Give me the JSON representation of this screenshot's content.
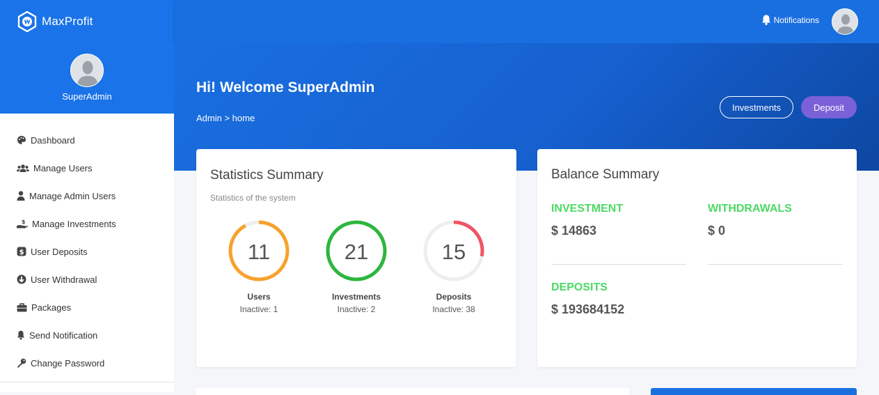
{
  "brand": {
    "name": "MaxProfit"
  },
  "topbar": {
    "notifications_label": "Notifications"
  },
  "profile": {
    "name": "SuperAdmin"
  },
  "sidebar": {
    "items": [
      {
        "label": "Dashboard",
        "icon": "palette-icon"
      },
      {
        "label": "Manage Users",
        "icon": "users-icon"
      },
      {
        "label": "Manage Admin Users",
        "icon": "user-icon"
      },
      {
        "label": "Manage Investments",
        "icon": "hand-dollar-icon"
      },
      {
        "label": "User Deposits",
        "icon": "dollar-badge-icon"
      },
      {
        "label": "User Withdrawal",
        "icon": "arrow-down-circle-icon"
      },
      {
        "label": "Packages",
        "icon": "briefcase-icon"
      },
      {
        "label": "Send Notification",
        "icon": "bell-icon"
      },
      {
        "label": "Change Password",
        "icon": "key-icon"
      }
    ]
  },
  "hero": {
    "title": "Hi! Welcome SuperAdmin",
    "breadcrumb": "Admin > home",
    "investments_button": "Investments",
    "deposit_button": "Deposit"
  },
  "stats": {
    "title": "Statistics Summary",
    "subtitle": "Statistics of the system",
    "items": [
      {
        "value": "11",
        "label": "Users",
        "sub": "Inactive: 1",
        "color": "#f7a22e",
        "fraction": 0.92
      },
      {
        "value": "21",
        "label": "Investments",
        "sub": "Inactive: 2",
        "color": "#2cb63e",
        "fraction": 1.0
      },
      {
        "value": "15",
        "label": "Deposits",
        "sub": "Inactive: 38",
        "color": "#ee5563",
        "fraction": 0.28
      }
    ]
  },
  "balance": {
    "title": "Balance Summary",
    "investment_label": "INVESTMENT",
    "investment_value": "$ 14863",
    "withdrawals_label": "WITHDRAWALS",
    "withdrawals_value": "$ 0",
    "deposits_label": "DEPOSITS",
    "deposits_value": "$ 193684152"
  },
  "colors": {
    "primary": "#1a73e8",
    "deposit_button": "#7b61d8",
    "balance_label": "#4cd964"
  }
}
